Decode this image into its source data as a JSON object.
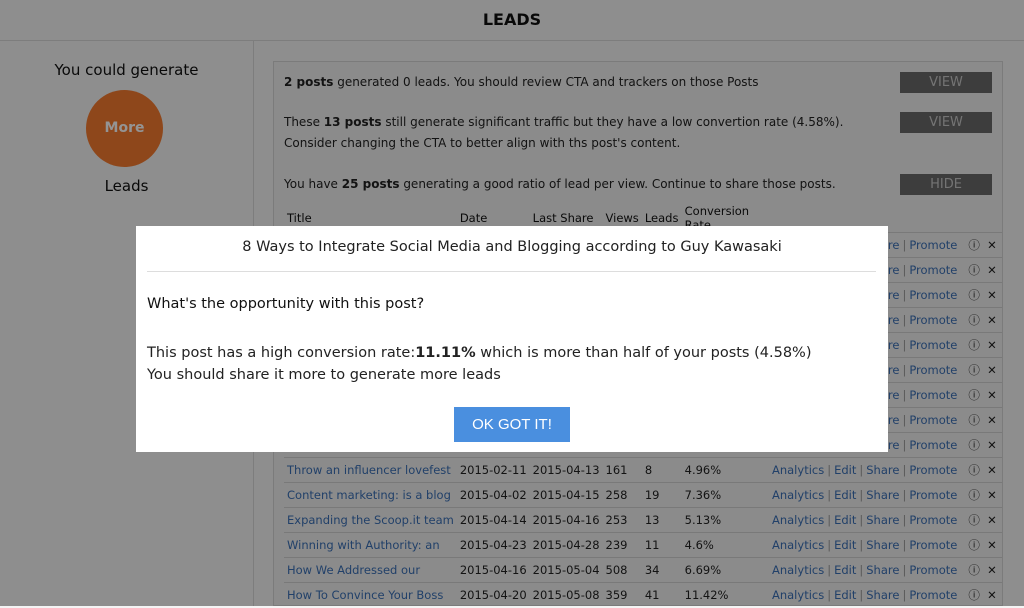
{
  "header": {
    "title": "LEADS"
  },
  "left": {
    "intro": "You could generate",
    "circle": "More",
    "label": "Leads",
    "circle_color": "#f57a2f"
  },
  "insights": [
    {
      "bold": "2 posts",
      "text": " generated 0 leads. You should review CTA and trackers on those Posts",
      "button": "VIEW"
    },
    {
      "pre": "These ",
      "bold": "13 posts",
      "text": " still generate significant traffic but they have a low convertion rate (4.58%). Consider changing the CTA to better align with ths post's content.",
      "button": "VIEW"
    },
    {
      "pre": "You have ",
      "bold": "25 posts",
      "text": " generating a good ratio of lead per view. Continue to share those posts.",
      "button": "HIDE"
    }
  ],
  "table": {
    "columns": [
      "Title",
      "Date",
      "Last Share",
      "Views",
      "Leads",
      "Conversion Rate"
    ],
    "actions": {
      "analytics": "Analytics",
      "edit": "Edit",
      "share": "Share",
      "promote": "Promote",
      "sep": "|",
      "info": "ⓘ",
      "remove": "✕"
    },
    "rows": [
      {
        "title": "",
        "date": "",
        "last": "",
        "views": "",
        "leads": "",
        "rate": ""
      },
      {
        "title": "",
        "date": "",
        "last": "",
        "views": "",
        "leads": "",
        "rate": ""
      },
      {
        "title": "",
        "date": "",
        "last": "",
        "views": "",
        "leads": "",
        "rate": ""
      },
      {
        "title": "",
        "date": "",
        "last": "",
        "views": "",
        "leads": "",
        "rate": ""
      },
      {
        "title": "",
        "date": "",
        "last": "",
        "views": "",
        "leads": "",
        "rate": ""
      },
      {
        "title": "",
        "date": "",
        "last": "",
        "views": "",
        "leads": "",
        "rate": ""
      },
      {
        "title": "",
        "date": "",
        "last": "",
        "views": "",
        "leads": "",
        "rate": ""
      },
      {
        "title": "",
        "date": "",
        "last": "",
        "views": "",
        "leads": "",
        "rate": ""
      },
      {
        "title": "",
        "date": "",
        "last": "",
        "views": "",
        "leads": "",
        "rate": ""
      },
      {
        "title": "Throw an influencer lovefest",
        "date": "2015-02-11",
        "last": "2015-04-13",
        "views": "161",
        "leads": "8",
        "rate": "4.96%"
      },
      {
        "title": "Content marketing: is a blog",
        "date": "2015-04-02",
        "last": "2015-04-15",
        "views": "258",
        "leads": "19",
        "rate": "7.36%"
      },
      {
        "title": "Expanding the Scoop.it team",
        "date": "2015-04-14",
        "last": "2015-04-16",
        "views": "253",
        "leads": "13",
        "rate": "5.13%"
      },
      {
        "title": "Winning with Authority: an",
        "date": "2015-04-23",
        "last": "2015-04-28",
        "views": "239",
        "leads": "11",
        "rate": "4.6%"
      },
      {
        "title": "How We Addressed our",
        "date": "2015-04-16",
        "last": "2015-05-04",
        "views": "508",
        "leads": "34",
        "rate": "6.69%"
      },
      {
        "title": "How To Convince Your Boss",
        "date": "2015-04-20",
        "last": "2015-05-08",
        "views": "359",
        "leads": "41",
        "rate": "11.42%"
      }
    ]
  },
  "modal": {
    "title": "8 Ways to Integrate Social Media and Blogging according to Guy Kawasaki",
    "question": "What's the opportunity with this post?",
    "line1_pre": "This post has a high conversion rate:",
    "line1_bold": "11.11%",
    "line1_post": " which is more than half of your posts (4.58%)",
    "line2": "You should share it more to generate more leads",
    "button": "OK GOT IT!",
    "button_color": "#4a8fdf"
  }
}
